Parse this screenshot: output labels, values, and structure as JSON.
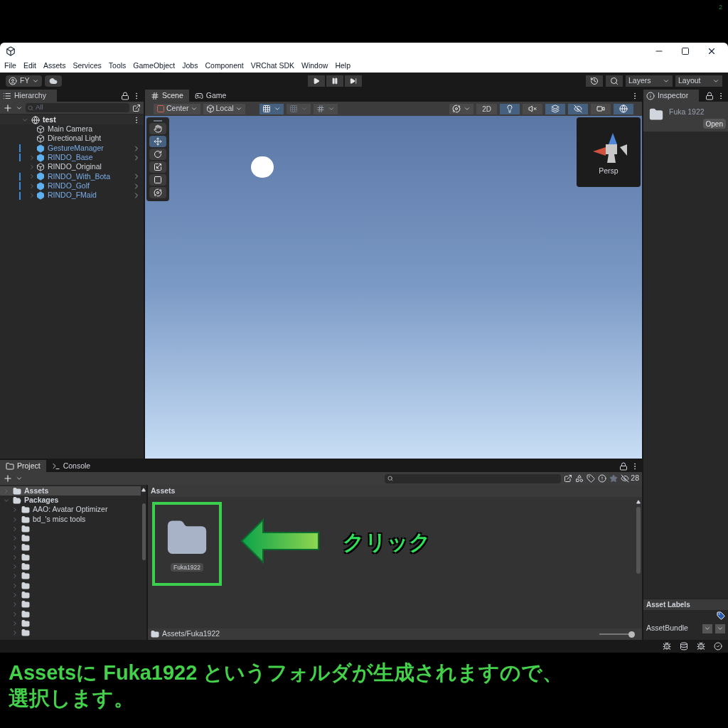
{
  "page_number": "2",
  "menu": [
    "File",
    "Edit",
    "Assets",
    "Services",
    "Tools",
    "GameObject",
    "Jobs",
    "Component",
    "VRChat SDK",
    "Window",
    "Help"
  ],
  "toolbar": {
    "account": "FY",
    "layers": "Layers",
    "layout": "Layout"
  },
  "hierarchy": {
    "title": "Hierarchy",
    "search_placeholder": "All",
    "scene": "test",
    "items": [
      {
        "name": "Main Camera",
        "kind": "object",
        "has_children": false
      },
      {
        "name": "Directional Light",
        "kind": "object",
        "has_children": false
      },
      {
        "name": "GestureManager",
        "kind": "prefab",
        "has_children": false
      },
      {
        "name": "RINDO_Base",
        "kind": "prefab",
        "has_children": true
      },
      {
        "name": "RINDO_Original",
        "kind": "object",
        "has_children": true
      },
      {
        "name": "RINDO_With_Bota",
        "kind": "prefab",
        "has_children": true
      },
      {
        "name": "RINDO_Golf",
        "kind": "prefab",
        "has_children": true
      },
      {
        "name": "RINDO_FMaid",
        "kind": "prefab",
        "has_children": true
      }
    ]
  },
  "scene": {
    "tabs": [
      {
        "label": "Scene",
        "kind": "scene",
        "selected": true
      },
      {
        "label": "Game",
        "kind": "game",
        "selected": false
      }
    ],
    "pivot": "Center",
    "space": "Local",
    "mode_2d": "2D",
    "camera_label": "Persp",
    "tools": [
      {
        "kind": "hand",
        "selected": false
      },
      {
        "kind": "move",
        "selected": true
      },
      {
        "kind": "rotate",
        "selected": false
      },
      {
        "kind": "scale",
        "selected": false
      },
      {
        "kind": "rect",
        "selected": false
      },
      {
        "kind": "transform",
        "selected": false
      }
    ],
    "toggles": [
      {
        "kind": "light",
        "on": true
      },
      {
        "kind": "audio",
        "on": false
      },
      {
        "kind": "effects",
        "on": true
      },
      {
        "kind": "visibility",
        "on": true
      },
      {
        "kind": "camera",
        "on": false
      },
      {
        "kind": "gizmos",
        "on": true
      }
    ]
  },
  "inspector": {
    "title": "Inspector",
    "asset_name": "Fuka 1922",
    "open_button": "Open",
    "labels_title": "Asset Labels",
    "bundle_label": "AssetBundle"
  },
  "project": {
    "tabs": [
      {
        "label": "Project",
        "kind": "project",
        "selected": true
      },
      {
        "label": "Console",
        "kind": "console",
        "selected": false
      }
    ],
    "tree": [
      {
        "name": "Assets",
        "expanded": false,
        "selected": true
      },
      {
        "name": "Packages",
        "expanded": true,
        "selected": false,
        "children": [
          {
            "name": "AAO: Avatar Optimizer",
            "expanded": false,
            "selected": false
          },
          {
            "name": "bd_'s misc tools",
            "expanded": false,
            "selected": false
          },
          {
            "expanded": false,
            "selected": false
          },
          {
            "expanded": false,
            "selected": false
          },
          {
            "expanded": false,
            "selected": false
          },
          {
            "expanded": false,
            "selected": false
          },
          {
            "expanded": false,
            "selected": false
          },
          {
            "expanded": false,
            "selected": false
          },
          {
            "expanded": false,
            "selected": false
          },
          {
            "expanded": false,
            "selected": false
          },
          {
            "expanded": false,
            "selected": false
          },
          {
            "expanded": false,
            "selected": false
          },
          {
            "expanded": false,
            "selected": false
          },
          {
            "expanded": false,
            "selected": false
          }
        ]
      }
    ],
    "breadcrumb": "Assets",
    "items": [
      {
        "name": "Fuka1922",
        "highlighted": true
      }
    ],
    "path": "Assets/Fuka1922",
    "hidden_count": "28",
    "zoom": {
      "level": 0.95
    }
  },
  "annotation": {
    "callout": "クリック",
    "caption": [
      "Assetsに Fuka1922 というフォルダが生成されますので、",
      "選択します。"
    ]
  }
}
